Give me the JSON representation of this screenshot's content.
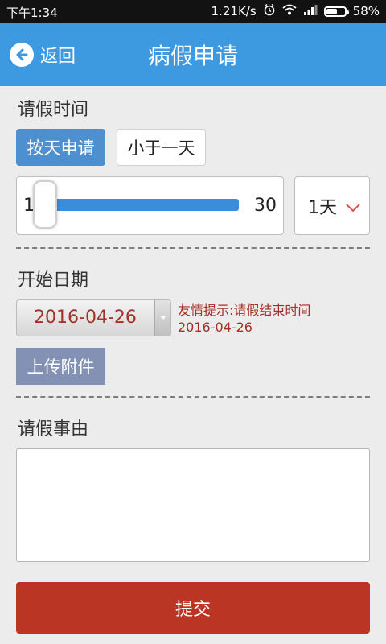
{
  "status_bar": {
    "time": "下午1:34",
    "net_speed": "1.21K/s",
    "battery": "58%",
    "battery_level": 0.58,
    "icons": [
      "alarm-icon",
      "wifi-icon",
      "signal-icon",
      "battery-icon"
    ]
  },
  "header": {
    "back_label": "返回",
    "title": "病假申请",
    "background": "#3e9ae0"
  },
  "leave_time": {
    "label": "请假时间",
    "tabs": [
      {
        "label": "按天申请",
        "active": true
      },
      {
        "label": "小于一天",
        "active": false
      }
    ],
    "slider": {
      "min_label": "1",
      "max_label": "30",
      "min": 1,
      "max": 30,
      "value": 1
    },
    "days_select": {
      "value": "1天"
    }
  },
  "start_date": {
    "label": "开始日期",
    "value": "2016-04-26",
    "hint": "友情提示:请假结束时间  2016-04-26"
  },
  "upload": {
    "label": "上传附件"
  },
  "reason": {
    "label": "请假事由",
    "value": ""
  },
  "submit": {
    "label": "提交",
    "color": "#bb3524"
  }
}
